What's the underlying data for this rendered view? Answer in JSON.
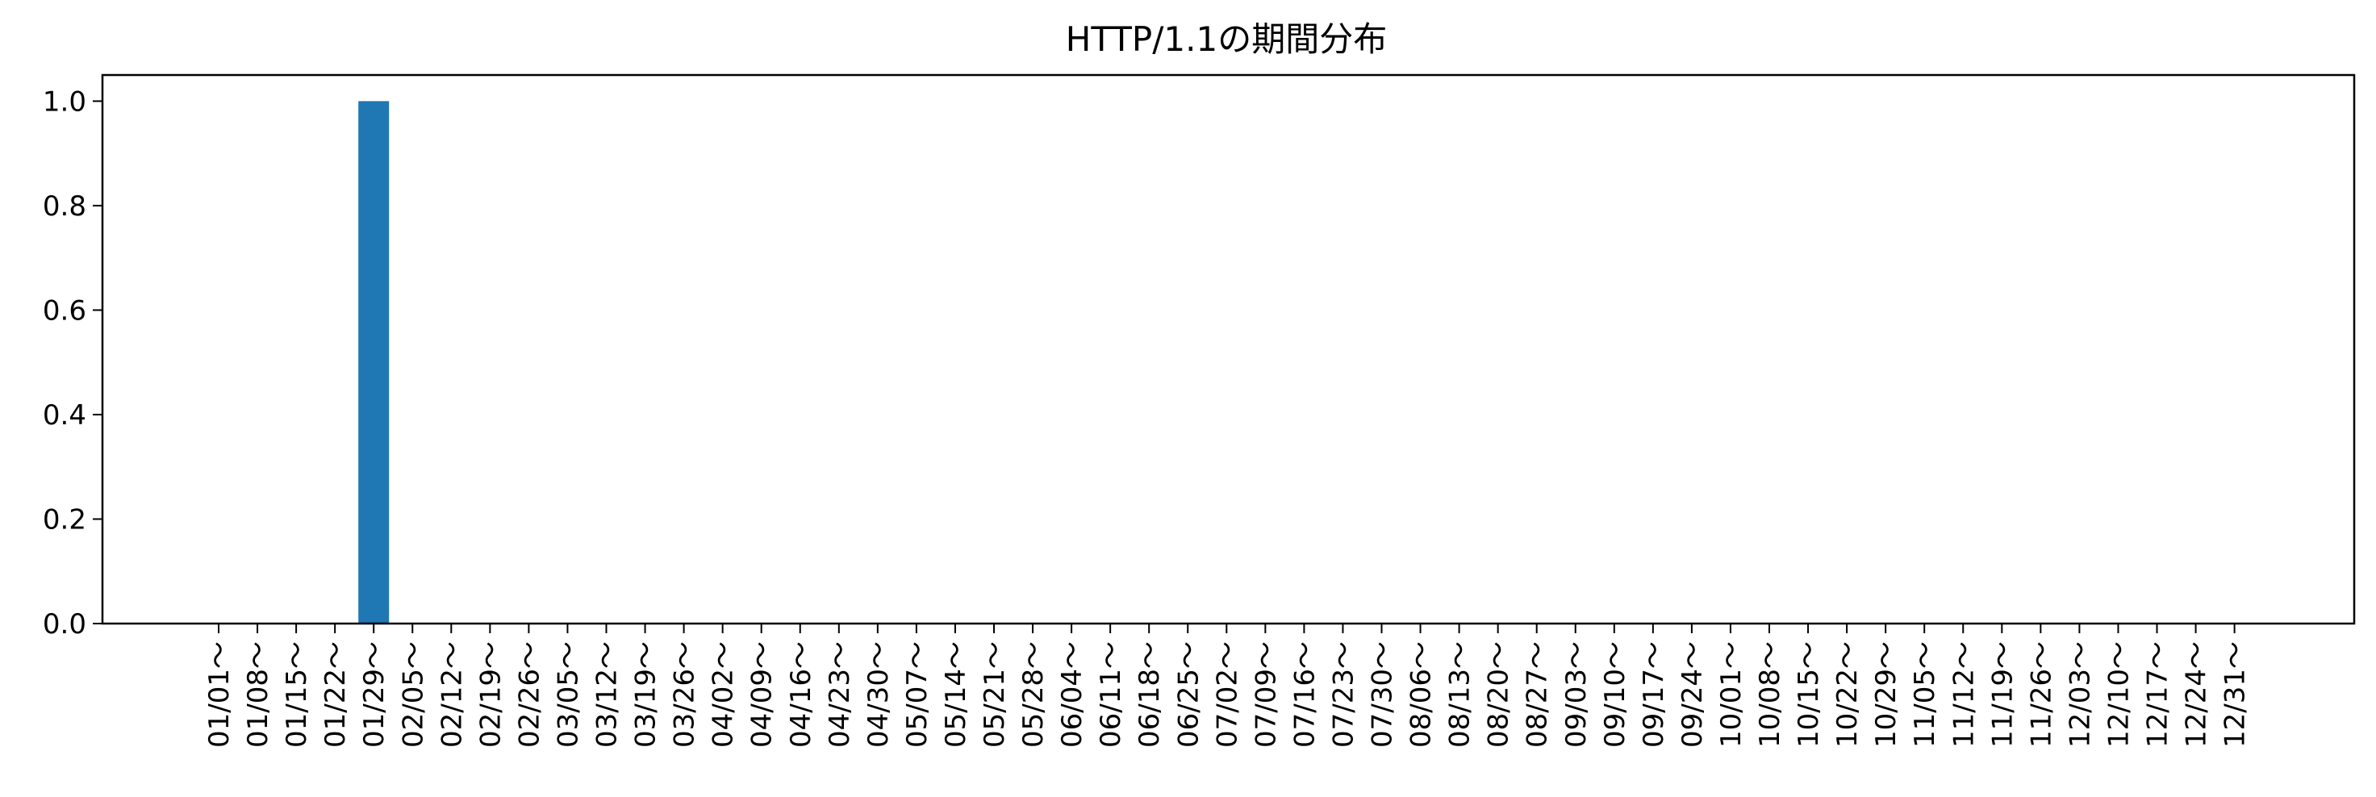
{
  "chart_data": {
    "type": "bar",
    "title": "HTTP/1.1の期間分布",
    "xlabel": "",
    "ylabel": "",
    "ylim": [
      0,
      1.05
    ],
    "yticks": [
      "0.0",
      "0.2",
      "0.4",
      "0.6",
      "0.8",
      "1.0"
    ],
    "bar_color": "#1f77b4",
    "grid": false,
    "categories": [
      "01/01～",
      "01/08～",
      "01/15～",
      "01/22～",
      "01/29～",
      "02/05～",
      "02/12～",
      "02/19～",
      "02/26～",
      "03/05～",
      "03/12～",
      "03/19～",
      "03/26～",
      "04/02～",
      "04/09～",
      "04/16～",
      "04/23～",
      "04/30～",
      "05/07～",
      "05/14～",
      "05/21～",
      "05/28～",
      "06/04～",
      "06/11～",
      "06/18～",
      "06/25～",
      "07/02～",
      "07/09～",
      "07/16～",
      "07/23～",
      "07/30～",
      "08/06～",
      "08/13～",
      "08/20～",
      "08/27～",
      "09/03～",
      "09/10～",
      "09/17～",
      "09/24～",
      "10/01～",
      "10/08～",
      "10/15～",
      "10/22～",
      "10/29～",
      "11/05～",
      "11/12～",
      "11/19～",
      "11/26～",
      "12/03～",
      "12/10～",
      "12/17～",
      "12/24～",
      "12/31～"
    ],
    "values": [
      0,
      0,
      0,
      0,
      1,
      0,
      0,
      0,
      0,
      0,
      0,
      0,
      0,
      0,
      0,
      0,
      0,
      0,
      0,
      0,
      0,
      0,
      0,
      0,
      0,
      0,
      0,
      0,
      0,
      0,
      0,
      0,
      0,
      0,
      0,
      0,
      0,
      0,
      0,
      0,
      0,
      0,
      0,
      0,
      0,
      0,
      0,
      0,
      0,
      0,
      0,
      0,
      0
    ]
  }
}
